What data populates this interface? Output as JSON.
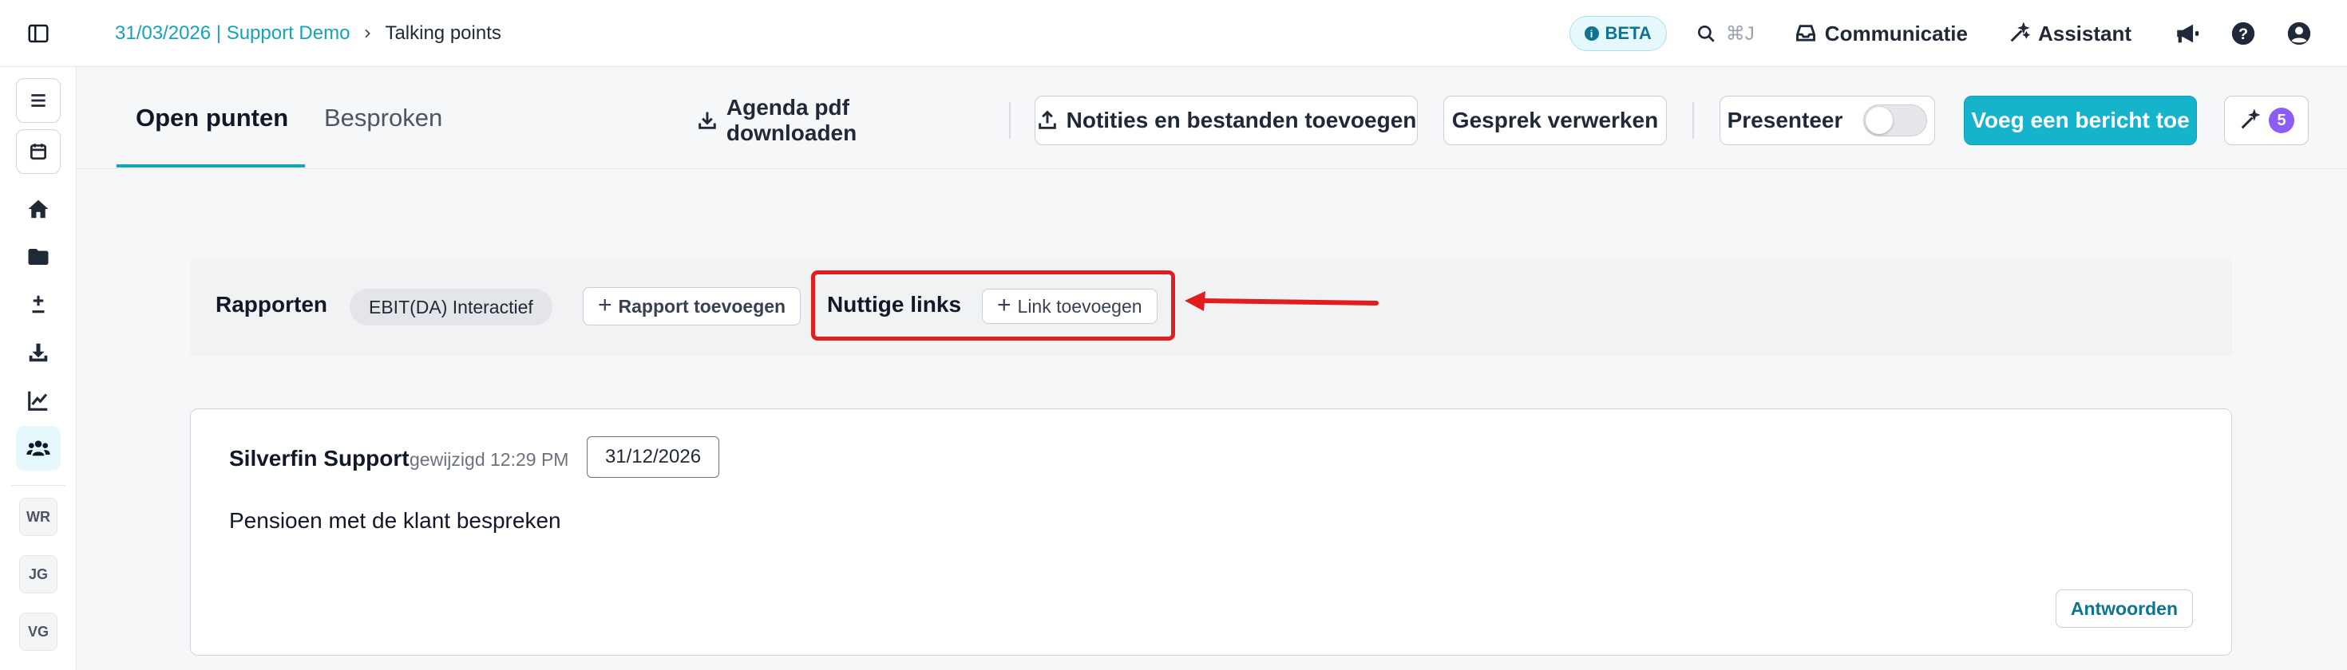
{
  "breadcrumb": {
    "parent": "31/03/2026 | Support Demo",
    "current": "Talking points"
  },
  "header": {
    "beta_label": "BETA",
    "shortcut": "⌘J",
    "communication_label": "Communicatie",
    "assistant_label": "Assistant"
  },
  "sidebar": {
    "avatars": [
      "WR",
      "JG",
      "VG"
    ]
  },
  "tabs": {
    "open": "Open punten",
    "discussed": "Besproken"
  },
  "toolbar": {
    "download_agenda": "Agenda pdf downloaden",
    "add_notes": "Notities en bestanden toevoegen",
    "process_meeting": "Gesprek verwerken",
    "present": "Presenteer",
    "add_message": "Voeg een bericht toe",
    "ai_count": "5"
  },
  "reports": {
    "label": "Rapporten",
    "chip": "EBIT(DA) Interactief",
    "add_report": "Rapport toevoegen",
    "links_label": "Nuttige links",
    "add_link": "Link toevoegen"
  },
  "comment": {
    "author": "Silverfin Support",
    "edited": "gewijzigd 12:29 PM",
    "date": "31/12/2026",
    "text": "Pensioen met de klant bespreken",
    "reply": "Antwoorden"
  },
  "colors": {
    "accent": "#16b4cc",
    "link": "#16a3b8",
    "highlight": "#e11d1d",
    "badge": "#8b5cf6"
  },
  "present_toggle_on": false
}
